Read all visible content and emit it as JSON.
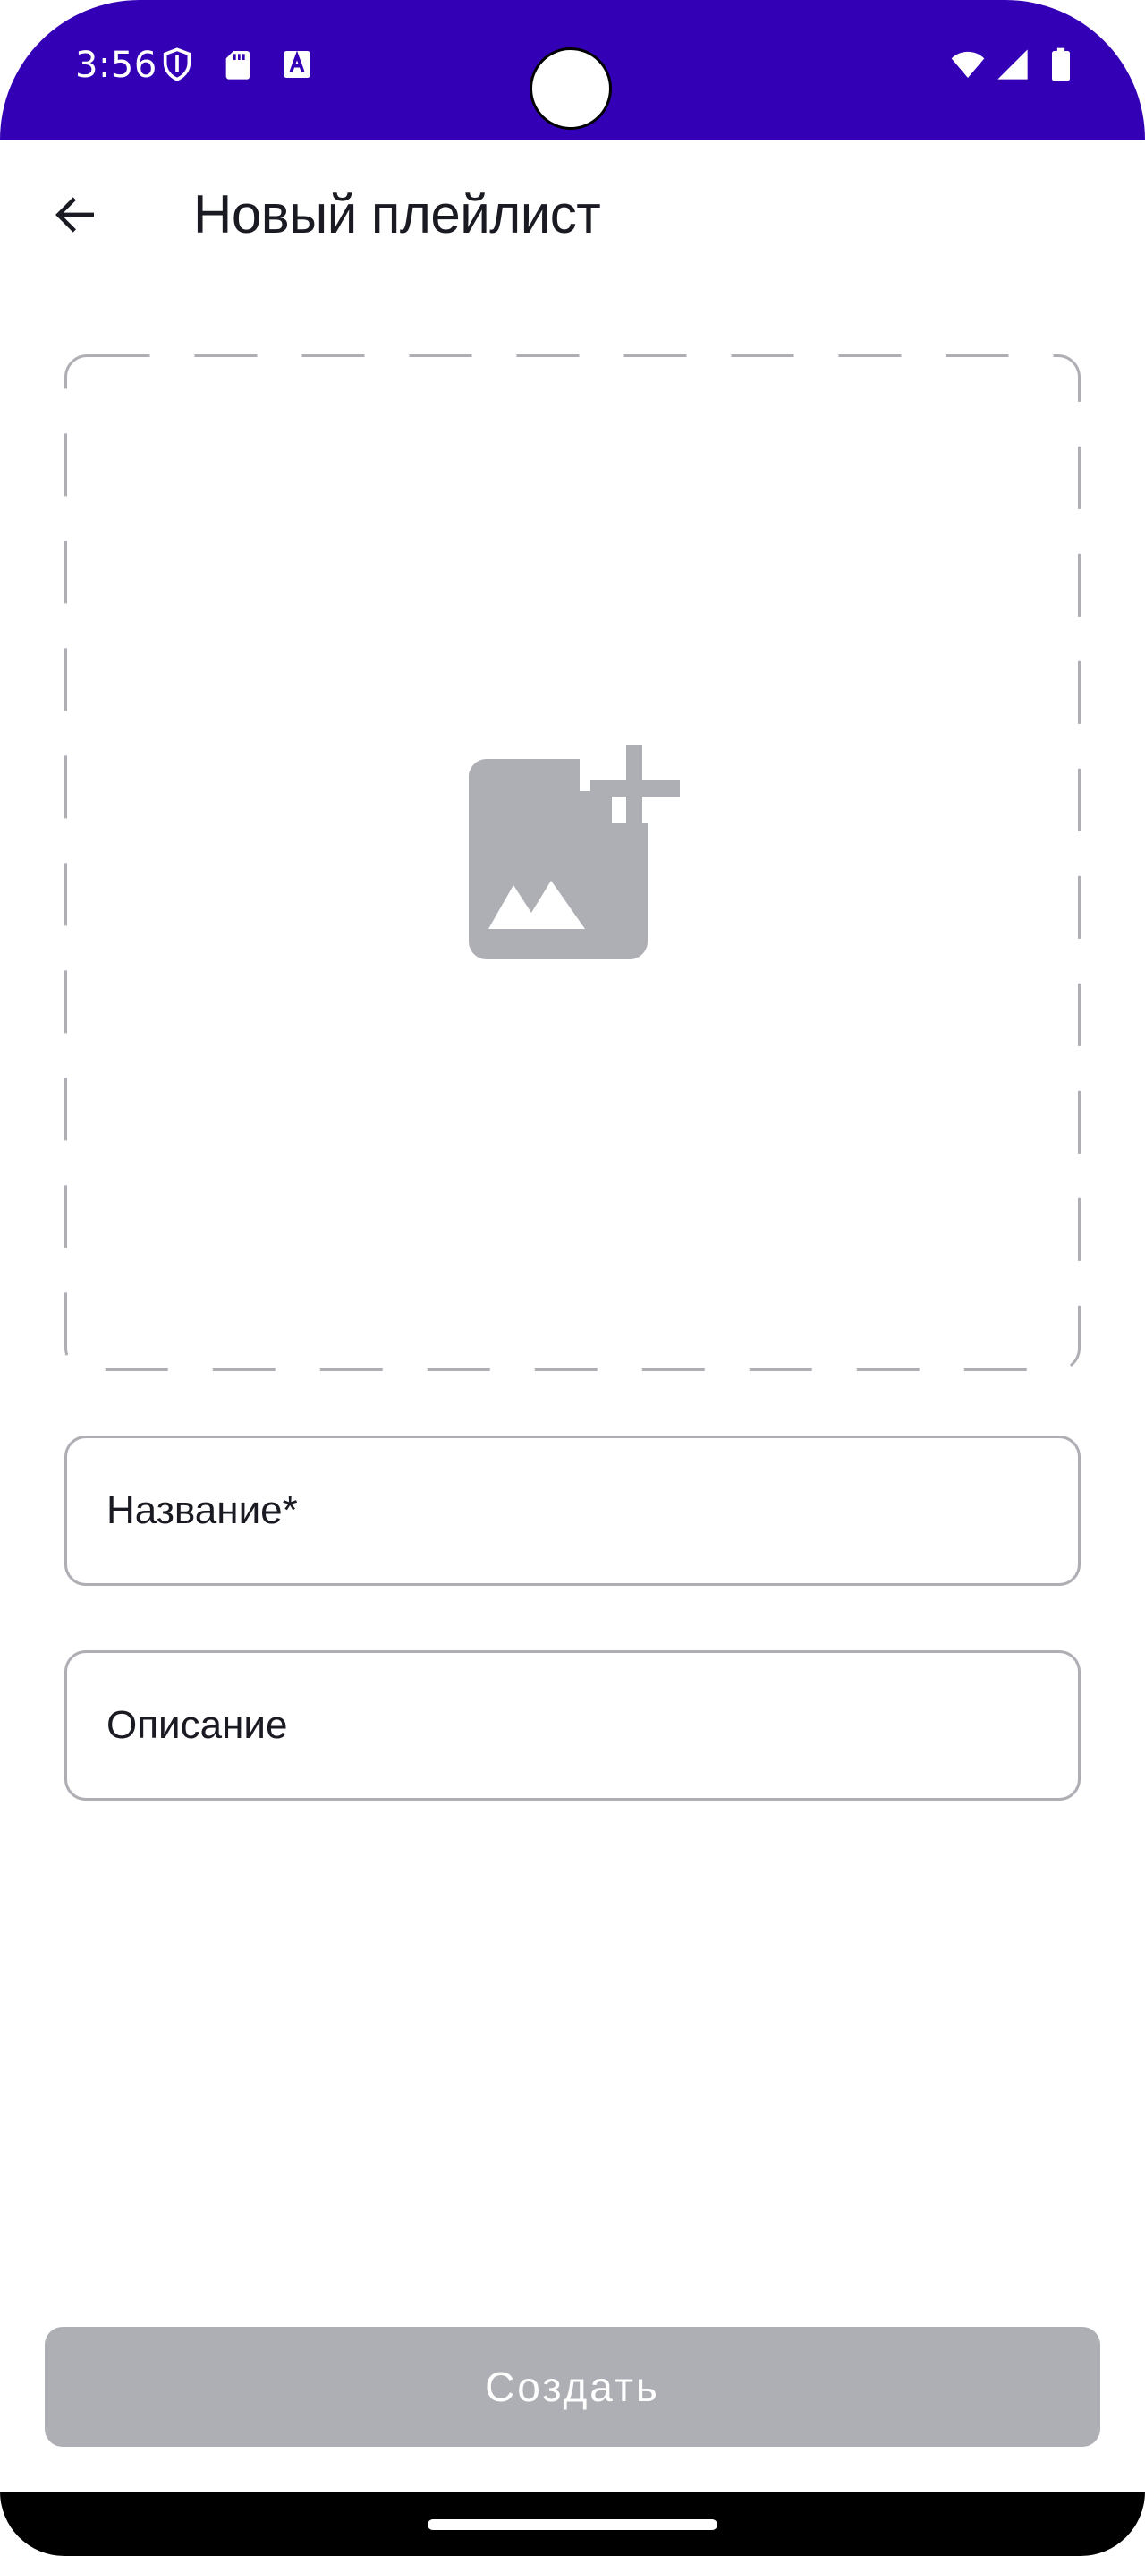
{
  "status_bar": {
    "time": "3:56",
    "left_icons": [
      "shield-icon",
      "sd-card-icon",
      "font-download-icon"
    ],
    "right_icons": [
      "wifi-icon",
      "cell-signal-icon",
      "battery-icon"
    ],
    "background_color": "#3400b5"
  },
  "toolbar": {
    "title": "Новый плейлист",
    "back_icon": "arrow-left-icon"
  },
  "image_picker": {
    "icon": "add-photo-icon",
    "icon_color": "#aeafb4",
    "border_color": "#aeafb4"
  },
  "form": {
    "name_placeholder": "Название*",
    "name_value": "",
    "description_placeholder": "Описание",
    "description_value": ""
  },
  "create_button": {
    "label": "Создать",
    "background_color": "#aeafb4",
    "enabled": false
  }
}
